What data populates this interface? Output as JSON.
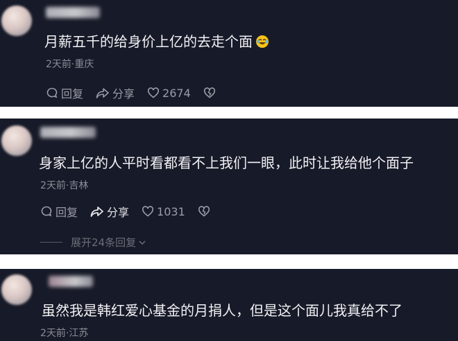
{
  "comments": [
    {
      "text": "月薪五千的给身价上亿的去走个面",
      "meta": "2天前·重庆",
      "reply_label": "回复",
      "share_label": "分享",
      "likes": "2674"
    },
    {
      "text": "身家上亿的人平时看都看不上我们一眼，此时让我给他个面子",
      "meta": "2天前·吉林",
      "reply_label": "回复",
      "share_label": "分享",
      "likes": "1031",
      "expand_label": "展开24条回复"
    },
    {
      "text": "虽然我是韩红爱心基金的月捐人，但是这个面儿我真给不了",
      "meta": "2天前·江苏"
    }
  ],
  "colors": {
    "card_bg": "#171a28",
    "text": "#f2f2f5",
    "muted": "#8b8d98"
  },
  "icons": [
    "comment-bubble-icon",
    "share-arrow-icon",
    "heart-icon",
    "broken-heart-icon",
    "laughing-tears-emoji-icon",
    "chevron-down-icon"
  ]
}
